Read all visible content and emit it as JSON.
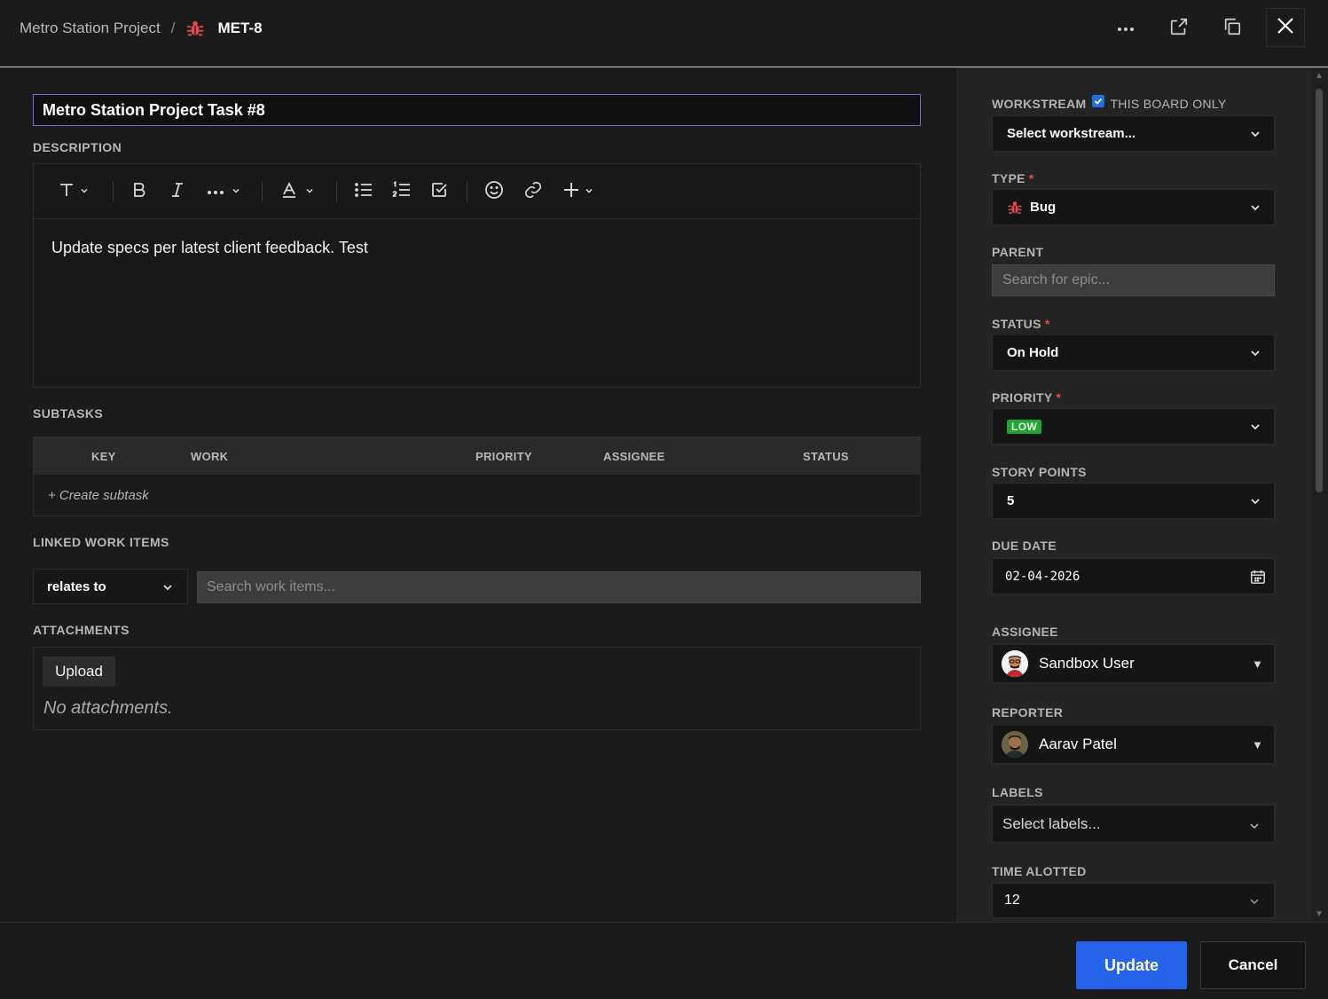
{
  "header": {
    "project": "Metro Station Project",
    "separator": "/",
    "issue_key": "MET-8"
  },
  "title": "Metro Station Project Task #8",
  "description": {
    "label": "DESCRIPTION",
    "text": "Update specs per latest client feedback. Test"
  },
  "subtasks": {
    "label": "SUBTASKS",
    "columns": [
      "KEY",
      "WORK",
      "PRIORITY",
      "ASSIGNEE",
      "STATUS"
    ],
    "create_label": "+ Create subtask"
  },
  "linked": {
    "label": "LINKED WORK ITEMS",
    "relation": "relates to",
    "search_placeholder": "Search work items..."
  },
  "attachments": {
    "label": "ATTACHMENTS",
    "upload_label": "Upload",
    "empty_text": "No attachments."
  },
  "sidebar": {
    "workstream": {
      "label": "WORKSTREAM",
      "checkbox_label": "THIS BOARD ONLY",
      "value": "Select workstream..."
    },
    "type": {
      "label": "TYPE",
      "value": "Bug"
    },
    "parent": {
      "label": "PARENT",
      "placeholder": "Search for epic..."
    },
    "status": {
      "label": "STATUS",
      "value": "On Hold"
    },
    "priority": {
      "label": "PRIORITY",
      "value": "LOW"
    },
    "story_points": {
      "label": "STORY POINTS",
      "value": "5"
    },
    "due_date": {
      "label": "DUE DATE",
      "value": "02-04-2026"
    },
    "assignee": {
      "label": "ASSIGNEE",
      "value": "Sandbox User"
    },
    "reporter": {
      "label": "REPORTER",
      "value": "Aarav Patel"
    },
    "labels": {
      "label": "LABELS",
      "value": "Select labels..."
    },
    "time_alotted": {
      "label": "TIME ALOTTED",
      "value": "12"
    },
    "required_mark": "*"
  },
  "footer": {
    "update_label": "Update",
    "cancel_label": "Cancel"
  },
  "colors": {
    "accent": "#2563eb",
    "bug": "#e5484d",
    "low_priority": "#1fa533",
    "focus_border": "#6d6bd8"
  }
}
